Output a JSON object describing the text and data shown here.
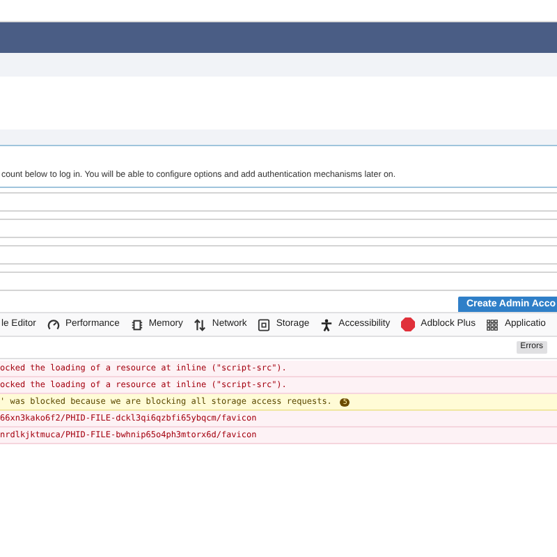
{
  "page": {
    "intro": "count below to log in. You will be able to configure options and add authentication mechanisms later on.",
    "submit_button": "Create Admin Acco"
  },
  "devtools": {
    "tabs": [
      {
        "label": "le Editor",
        "selected": false
      },
      {
        "label": "Performance",
        "selected": false
      },
      {
        "label": "Memory",
        "selected": false
      },
      {
        "label": "Network",
        "selected": false
      },
      {
        "label": "Storage",
        "selected": false
      },
      {
        "label": "Accessibility",
        "selected": false
      },
      {
        "label": "Adblock Plus",
        "selected": false
      },
      {
        "label": "Applicatio",
        "selected": false
      }
    ],
    "filters": [
      {
        "label": "Errors",
        "selected": true
      }
    ],
    "messages": [
      {
        "kind": "error",
        "text": "ocked the loading of a resource at inline (\"script-src\")."
      },
      {
        "kind": "error",
        "text": "ocked the loading of a resource at inline (\"script-src\")."
      },
      {
        "kind": "warning",
        "text": "' was blocked because we are blocking all storage access requests.",
        "count": "5"
      },
      {
        "kind": "error",
        "text": "66xn3kako6f2/PHID-FILE-dckl3qi6qzbfi65ybqcm/favicon"
      },
      {
        "kind": "error",
        "text": "nrdlkjktmuca/PHID-FILE-bwhnip65o4ph3mtorx6d/favicon"
      }
    ]
  }
}
